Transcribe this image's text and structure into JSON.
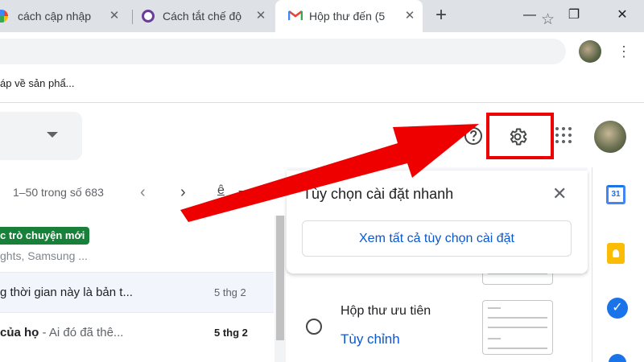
{
  "browser": {
    "tabs": [
      {
        "title": "cách cập nhập",
        "favicon": "google-g-icon"
      },
      {
        "title": "Cách tắt chế độ",
        "favicon": "tor-like-purple-icon"
      },
      {
        "title": "Hộp thư đến (5",
        "favicon": "gmail-m-icon"
      }
    ],
    "close_glyph": "✕",
    "new_tab_glyph": "+",
    "window_controls": [
      "—",
      "❐",
      "✕"
    ],
    "bookmark": "áp về sản phẩ..."
  },
  "gmail": {
    "pagination": "1–50 trong số 683",
    "prev_glyph": "‹",
    "next_glyph": "›",
    "lang_glyph": "ê",
    "emails": [
      {
        "chip": "c trò chuyện mới",
        "preview": "ghts, Samsung ..."
      },
      {
        "subject": "g thời gian này là bản t...",
        "date": "5 thg 2",
        "bold": false
      },
      {
        "subject_bold": " của họ",
        "subject_rest": " - Ai đó đã thê...",
        "date": "5 thg 2",
        "bold": true
      }
    ]
  },
  "quick_settings": {
    "title": "Tùy chọn cài đặt nhanh",
    "close_glyph": "✕",
    "see_all": "Xem tất cả tùy chọn cài đặt",
    "option_label": "Hộp thư ưu tiên",
    "option_link": "Tùy chỉnh"
  },
  "side_panel": {
    "calendar_day": "31",
    "tasks_glyph": "✓"
  },
  "colors": {
    "highlight": "#ee0000",
    "arrow": "#ee0000",
    "link": "#0b57d0",
    "chip": "#188038"
  }
}
